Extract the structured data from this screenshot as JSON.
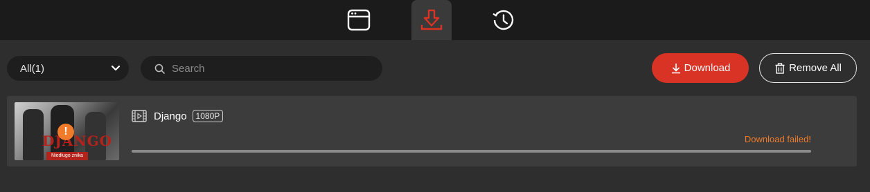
{
  "tabs": {
    "browser_icon": "browser-window-icon",
    "download_icon": "download-tray-icon",
    "history_icon": "history-clock-icon",
    "active": "download"
  },
  "toolbar": {
    "filter_value": "All(1)",
    "search_placeholder": "Search",
    "download_label": "Download",
    "remove_all_label": "Remove All"
  },
  "tasks": [
    {
      "title": "Django",
      "quality": "1080P",
      "status": "Download failed!",
      "progress_fraction": 1.0,
      "thumbnail_poster_title": "DJANGO",
      "thumbnail_poster_subtitle": "Niedługo znika"
    }
  ],
  "colors": {
    "accent_red": "#d83325",
    "error_orange": "#f07b2a",
    "background": "#2b2b2b",
    "row_background": "#3c3c3c"
  }
}
